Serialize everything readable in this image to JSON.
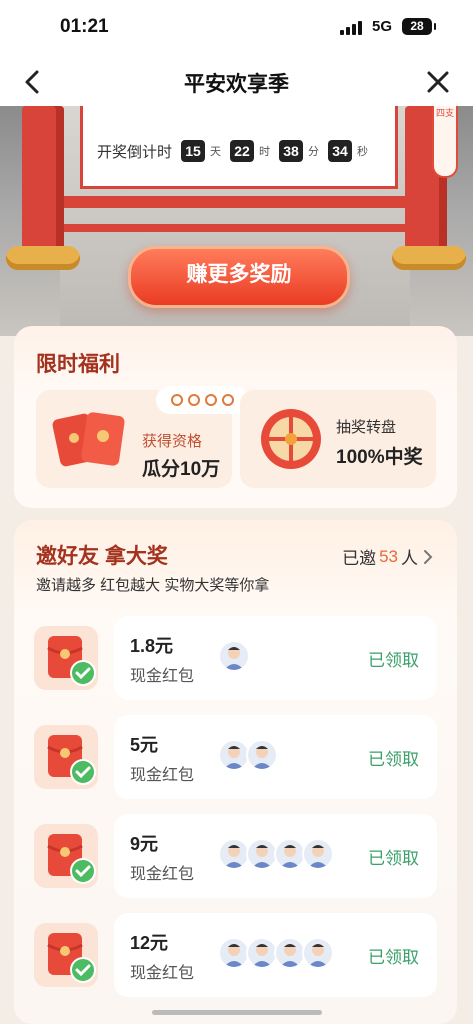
{
  "status_bar": {
    "time": "01:21",
    "network": "5G",
    "battery": "28"
  },
  "nav": {
    "title": "平安欢享季"
  },
  "countdown": {
    "label": "开奖倒计时",
    "days": "15",
    "days_unit": "天",
    "hours": "22",
    "hours_unit": "时",
    "minutes": "38",
    "minutes_unit": "分",
    "seconds": "34",
    "seconds_unit": "秒"
  },
  "side_tag": "四支",
  "earn_button": "赚更多奖励",
  "limited": {
    "title": "限时福利",
    "tile1": {
      "sub": "获得资格",
      "main": "瓜分10万"
    },
    "tile2": {
      "sub": "抽奖转盘",
      "main": "100%中奖"
    }
  },
  "invite": {
    "title": "邀好友 拿大奖",
    "subtitle": "邀请越多 红包越大 实物大奖等你拿",
    "invited_prefix": "已邀",
    "invited_count": "53",
    "invited_suffix": "人",
    "rewards": [
      {
        "amount": "1.8元",
        "kind": "现金红包",
        "status": "已领取",
        "avatars": 1
      },
      {
        "amount": "5元",
        "kind": "现金红包",
        "status": "已领取",
        "avatars": 2
      },
      {
        "amount": "9元",
        "kind": "现金红包",
        "status": "已领取",
        "avatars": 4
      },
      {
        "amount": "12元",
        "kind": "现金红包",
        "status": "已领取",
        "avatars": 4
      }
    ]
  },
  "colors": {
    "accent": "#a3321f",
    "button": "#ea3b24",
    "claimed": "#3aa06a"
  }
}
